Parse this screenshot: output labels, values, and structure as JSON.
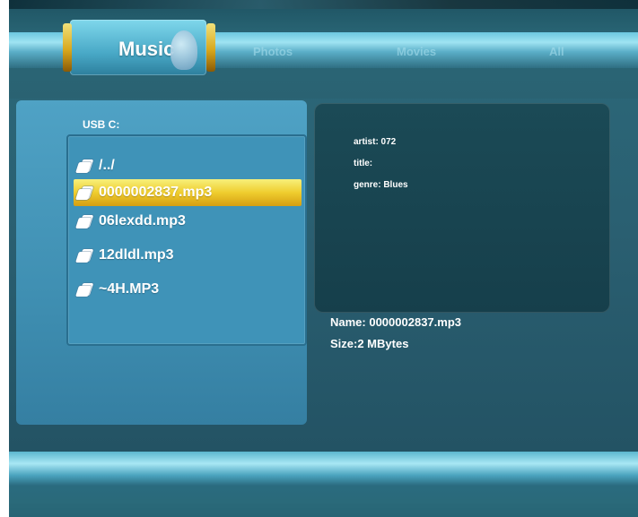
{
  "tabs": {
    "active": "Music",
    "others": [
      "Photos",
      "Movies",
      "All"
    ]
  },
  "browser": {
    "path": "USB    C:",
    "items": [
      {
        "label": "/../",
        "selected": false
      },
      {
        "label": "0000002837.mp3",
        "selected": true
      },
      {
        "label": "06lexdd.mp3",
        "selected": false
      },
      {
        "label": "12dldl.mp3",
        "selected": false
      },
      {
        "label": "~4H.MP3",
        "selected": false
      }
    ]
  },
  "info": {
    "artist": "artist: 072",
    "title": "title:",
    "genre": "genre: Blues"
  },
  "file": {
    "name": "Name: 0000002837.mp3",
    "size": "Size:2 MBytes"
  },
  "colors": {
    "accent": "#efcd2e",
    "panel": "#3f93b8",
    "background": "#2a5f71"
  }
}
